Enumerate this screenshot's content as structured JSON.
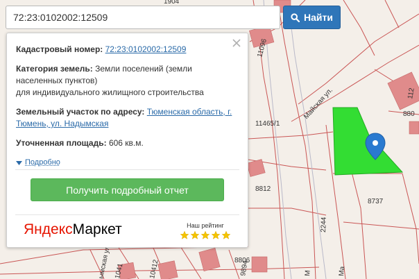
{
  "search": {
    "value": "72:23:0102002:12509",
    "button_label": "Найти",
    "icon": "search-icon"
  },
  "popup": {
    "cadastral_label": "Кадастровый номер:",
    "cadastral_value": "72:23:0102002:12509",
    "category_label": "Категория земель:",
    "category_value": "Земли поселений (земли населенных пунктов)",
    "category_use": "для индивидуального жилищного строительства",
    "address_label": "Земельный участок по адресу:",
    "address_value": "Тюменская область, г. Тюмень, ул. Надымская",
    "area_label": "Уточненная площадь:",
    "area_value": "606 кв.м.",
    "more_label": "Подробно",
    "report_button": "Получить подробный отчет",
    "market_logo_ya": "Яндекс",
    "market_logo_market": "Маркет",
    "rating_label": "Наш рейтинг",
    "rating_stars": 5,
    "rating_max": 5
  },
  "map": {
    "labels": {
      "street_top": "Майская ул.",
      "plot_11465": "11465/1",
      "plot_8812": "8812",
      "plot_8737": "8737",
      "plot_2244": "2244",
      "plot_880": "880",
      "plot_112": "112",
      "plot_11096": "11096",
      "plot_8806": "8806",
      "plot_9894": "9894",
      "plot_10412": "10412",
      "plot_10411": "1041",
      "street_bottom_left": "ымская ул.",
      "street_bottom_m1": "М",
      "street_bottom_m2": "Ма",
      "plot_1904": "1904"
    },
    "colors": {
      "parcel_fill": "#33dd33",
      "parcel_line": "#c23b3b",
      "building": "#e08b8b",
      "background": "#f4efe9",
      "marker": "#2a7ad0"
    }
  }
}
